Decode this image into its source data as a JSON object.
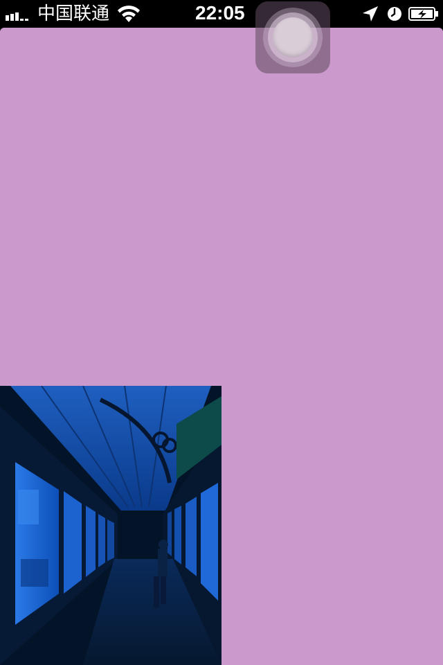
{
  "status_bar": {
    "carrier": "中国联通",
    "time": "22:05",
    "signal_bars": 3,
    "icons": [
      "signal-icon",
      "wifi-icon",
      "location-icon",
      "alarm-icon",
      "battery-charging-icon"
    ]
  },
  "app": {
    "background_color": "#cc99cc",
    "photo": {
      "subject": "museum-corridor-photo"
    }
  },
  "assistive_touch": {
    "icon": "assistive-touch-icon"
  }
}
